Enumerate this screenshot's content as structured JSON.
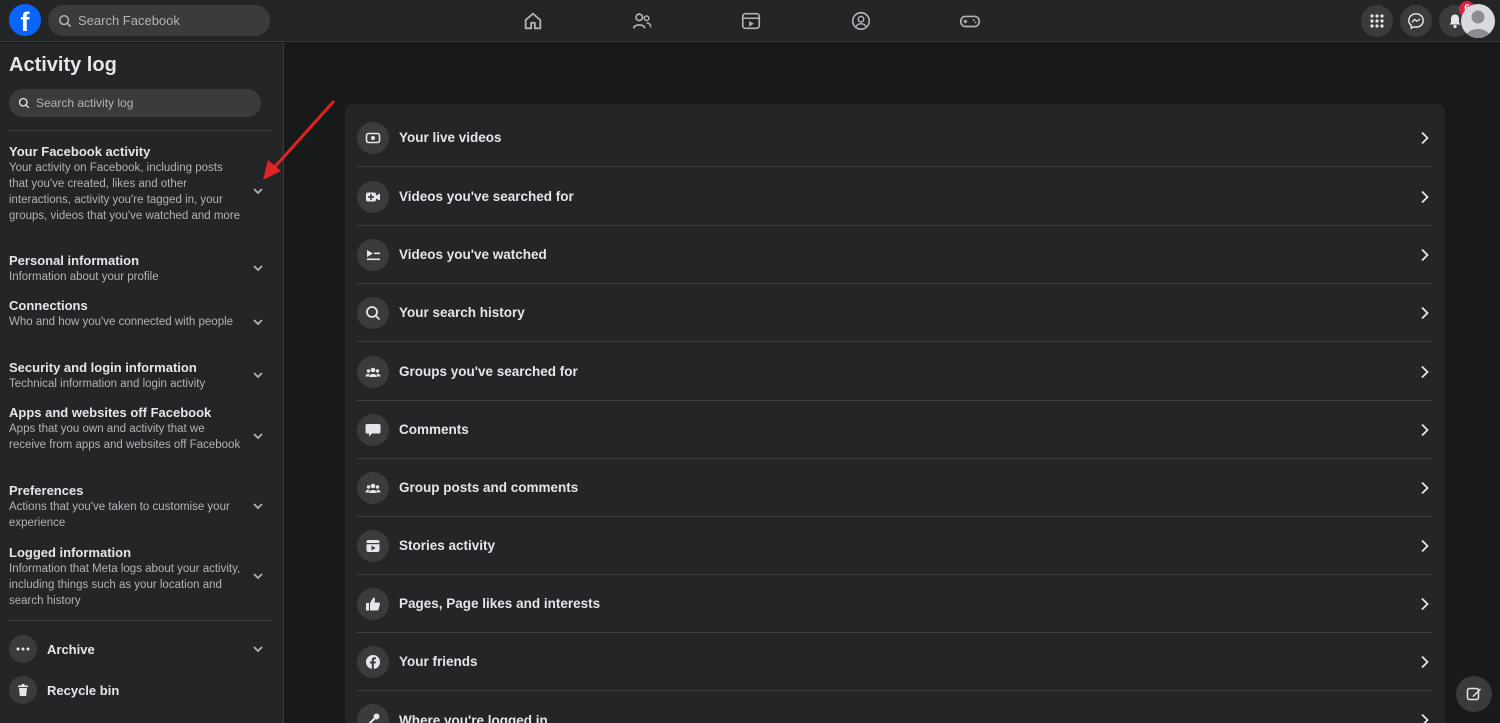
{
  "topbar": {
    "logo_letter": "f",
    "search_placeholder": "Search Facebook",
    "nav_icons": [
      "home-icon",
      "friends-icon",
      "video-icon",
      "groups-icon",
      "gaming-icon"
    ],
    "notifications_count": "6"
  },
  "sidebar": {
    "title": "Activity log",
    "search_placeholder": "Search activity log",
    "sections": [
      {
        "title": "Your Facebook activity",
        "description": "Your activity on Facebook, including posts that you've created, likes and other interactions, activity you're tagged in, your groups, videos that you've watched and more"
      },
      {
        "title": "Personal information",
        "description": "Information about your profile"
      },
      {
        "title": "Connections",
        "description": "Who and how you've connected with people"
      },
      {
        "title": "Security and login information",
        "description": "Technical information and login activity"
      },
      {
        "title": "Apps and websites off Facebook",
        "description": "Apps that you own and activity that we receive from apps and websites off Facebook"
      },
      {
        "title": "Preferences",
        "description": "Actions that you've taken to customise your experience"
      },
      {
        "title": "Logged information",
        "description": "Information that Meta logs about your activity, including things such as your location and search history"
      }
    ],
    "archive_label": "Archive",
    "recycle_bin_label": "Recycle bin"
  },
  "main": {
    "rows": [
      {
        "label": "Your live videos",
        "icon": "live-video-icon"
      },
      {
        "label": "Videos you've searched for",
        "icon": "video-search-icon"
      },
      {
        "label": "Videos you've watched",
        "icon": "watched-videos-icon"
      },
      {
        "label": "Your search history",
        "icon": "search-icon"
      },
      {
        "label": "Groups you've searched for",
        "icon": "groups-icon"
      },
      {
        "label": "Comments",
        "icon": "comment-icon"
      },
      {
        "label": "Group posts and comments",
        "icon": "groups-icon"
      },
      {
        "label": "Stories activity",
        "icon": "stories-icon"
      },
      {
        "label": "Pages, Page likes and interests",
        "icon": "thumbs-up-icon"
      },
      {
        "label": "Your friends",
        "icon": "facebook-icon"
      },
      {
        "label": "Where you're logged in",
        "icon": "key-icon"
      }
    ]
  },
  "colors": {
    "background": "#18191a",
    "surface": "#242526",
    "brand": "#0866ff",
    "annotation_arrow": "#e02424",
    "badge": "#e41e3f"
  }
}
